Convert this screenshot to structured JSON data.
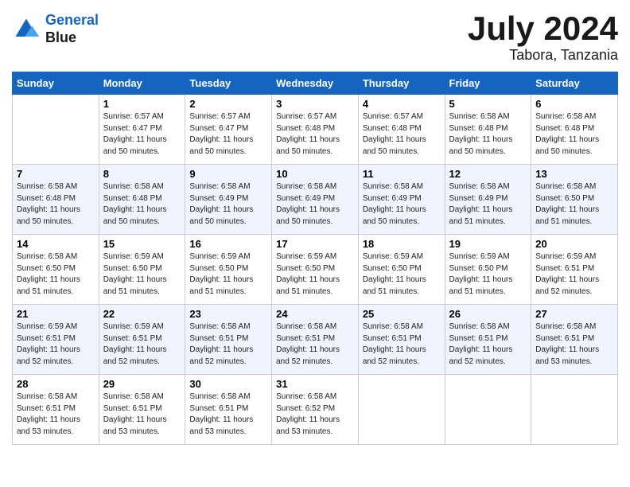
{
  "header": {
    "logo_line1": "General",
    "logo_line2": "Blue",
    "month_year": "July 2024",
    "location": "Tabora, Tanzania"
  },
  "weekdays": [
    "Sunday",
    "Monday",
    "Tuesday",
    "Wednesday",
    "Thursday",
    "Friday",
    "Saturday"
  ],
  "weeks": [
    [
      {
        "day": "",
        "info": ""
      },
      {
        "day": "1",
        "info": "Sunrise: 6:57 AM\nSunset: 6:47 PM\nDaylight: 11 hours\nand 50 minutes."
      },
      {
        "day": "2",
        "info": "Sunrise: 6:57 AM\nSunset: 6:47 PM\nDaylight: 11 hours\nand 50 minutes."
      },
      {
        "day": "3",
        "info": "Sunrise: 6:57 AM\nSunset: 6:48 PM\nDaylight: 11 hours\nand 50 minutes."
      },
      {
        "day": "4",
        "info": "Sunrise: 6:57 AM\nSunset: 6:48 PM\nDaylight: 11 hours\nand 50 minutes."
      },
      {
        "day": "5",
        "info": "Sunrise: 6:58 AM\nSunset: 6:48 PM\nDaylight: 11 hours\nand 50 minutes."
      },
      {
        "day": "6",
        "info": "Sunrise: 6:58 AM\nSunset: 6:48 PM\nDaylight: 11 hours\nand 50 minutes."
      }
    ],
    [
      {
        "day": "7",
        "info": "Sunrise: 6:58 AM\nSunset: 6:48 PM\nDaylight: 11 hours\nand 50 minutes."
      },
      {
        "day": "8",
        "info": "Sunrise: 6:58 AM\nSunset: 6:48 PM\nDaylight: 11 hours\nand 50 minutes."
      },
      {
        "day": "9",
        "info": "Sunrise: 6:58 AM\nSunset: 6:49 PM\nDaylight: 11 hours\nand 50 minutes."
      },
      {
        "day": "10",
        "info": "Sunrise: 6:58 AM\nSunset: 6:49 PM\nDaylight: 11 hours\nand 50 minutes."
      },
      {
        "day": "11",
        "info": "Sunrise: 6:58 AM\nSunset: 6:49 PM\nDaylight: 11 hours\nand 50 minutes."
      },
      {
        "day": "12",
        "info": "Sunrise: 6:58 AM\nSunset: 6:49 PM\nDaylight: 11 hours\nand 51 minutes."
      },
      {
        "day": "13",
        "info": "Sunrise: 6:58 AM\nSunset: 6:50 PM\nDaylight: 11 hours\nand 51 minutes."
      }
    ],
    [
      {
        "day": "14",
        "info": "Sunrise: 6:58 AM\nSunset: 6:50 PM\nDaylight: 11 hours\nand 51 minutes."
      },
      {
        "day": "15",
        "info": "Sunrise: 6:59 AM\nSunset: 6:50 PM\nDaylight: 11 hours\nand 51 minutes."
      },
      {
        "day": "16",
        "info": "Sunrise: 6:59 AM\nSunset: 6:50 PM\nDaylight: 11 hours\nand 51 minutes."
      },
      {
        "day": "17",
        "info": "Sunrise: 6:59 AM\nSunset: 6:50 PM\nDaylight: 11 hours\nand 51 minutes."
      },
      {
        "day": "18",
        "info": "Sunrise: 6:59 AM\nSunset: 6:50 PM\nDaylight: 11 hours\nand 51 minutes."
      },
      {
        "day": "19",
        "info": "Sunrise: 6:59 AM\nSunset: 6:50 PM\nDaylight: 11 hours\nand 51 minutes."
      },
      {
        "day": "20",
        "info": "Sunrise: 6:59 AM\nSunset: 6:51 PM\nDaylight: 11 hours\nand 52 minutes."
      }
    ],
    [
      {
        "day": "21",
        "info": "Sunrise: 6:59 AM\nSunset: 6:51 PM\nDaylight: 11 hours\nand 52 minutes."
      },
      {
        "day": "22",
        "info": "Sunrise: 6:59 AM\nSunset: 6:51 PM\nDaylight: 11 hours\nand 52 minutes."
      },
      {
        "day": "23",
        "info": "Sunrise: 6:58 AM\nSunset: 6:51 PM\nDaylight: 11 hours\nand 52 minutes."
      },
      {
        "day": "24",
        "info": "Sunrise: 6:58 AM\nSunset: 6:51 PM\nDaylight: 11 hours\nand 52 minutes."
      },
      {
        "day": "25",
        "info": "Sunrise: 6:58 AM\nSunset: 6:51 PM\nDaylight: 11 hours\nand 52 minutes."
      },
      {
        "day": "26",
        "info": "Sunrise: 6:58 AM\nSunset: 6:51 PM\nDaylight: 11 hours\nand 52 minutes."
      },
      {
        "day": "27",
        "info": "Sunrise: 6:58 AM\nSunset: 6:51 PM\nDaylight: 11 hours\nand 53 minutes."
      }
    ],
    [
      {
        "day": "28",
        "info": "Sunrise: 6:58 AM\nSunset: 6:51 PM\nDaylight: 11 hours\nand 53 minutes."
      },
      {
        "day": "29",
        "info": "Sunrise: 6:58 AM\nSunset: 6:51 PM\nDaylight: 11 hours\nand 53 minutes."
      },
      {
        "day": "30",
        "info": "Sunrise: 6:58 AM\nSunset: 6:51 PM\nDaylight: 11 hours\nand 53 minutes."
      },
      {
        "day": "31",
        "info": "Sunrise: 6:58 AM\nSunset: 6:52 PM\nDaylight: 11 hours\nand 53 minutes."
      },
      {
        "day": "",
        "info": ""
      },
      {
        "day": "",
        "info": ""
      },
      {
        "day": "",
        "info": ""
      }
    ]
  ]
}
